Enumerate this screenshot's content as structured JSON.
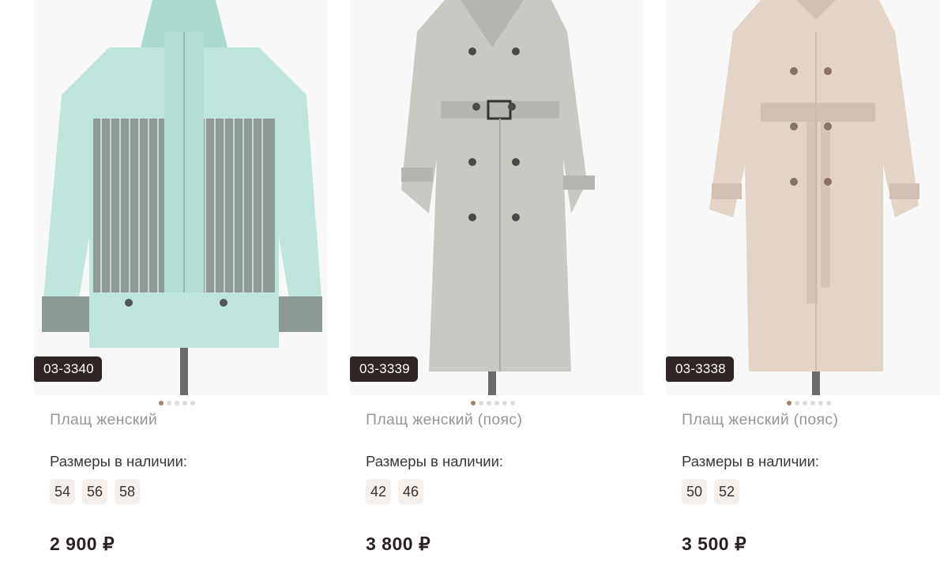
{
  "products": [
    {
      "sku": "03-3340",
      "title": "Плащ женский",
      "sizes_label": "Размеры в наличии:",
      "sizes": [
        "54",
        "56",
        "58"
      ],
      "price": "2 900 ₽",
      "image_color": "#bfe6dc",
      "gallery_dots": 5,
      "active_dot": 0
    },
    {
      "sku": "03-3339",
      "title": "Плащ женский (пояс)",
      "sizes_label": "Размеры в наличии:",
      "sizes": [
        "42",
        "46"
      ],
      "price": "3 800 ₽",
      "image_color": "#c9c9c4",
      "gallery_dots": 6,
      "active_dot": 0
    },
    {
      "sku": "03-3338",
      "title": "Плащ женский (пояс)",
      "sizes_label": "Размеры в наличии:",
      "sizes": [
        "50",
        "52"
      ],
      "price": "3 500 ₽",
      "image_color": "#e3d4c8",
      "gallery_dots": 6,
      "active_dot": 0
    }
  ]
}
